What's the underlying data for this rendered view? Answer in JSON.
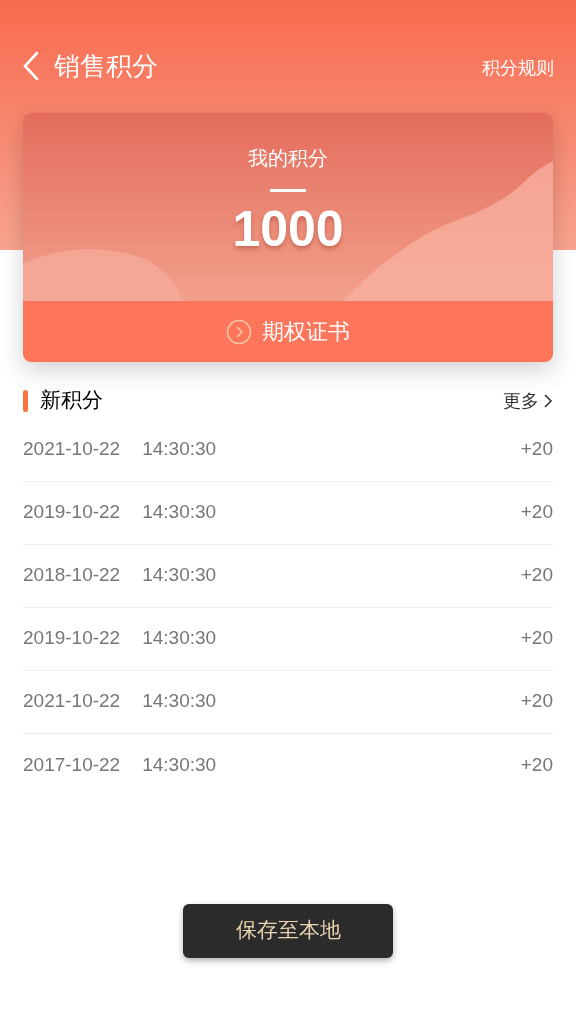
{
  "header": {
    "title": "销售积分",
    "rules_link": "积分规则"
  },
  "points_card": {
    "label": "我的积分",
    "value": "1000",
    "certificate_link": "期权证书"
  },
  "section": {
    "title": "新积分",
    "more_link": "更多"
  },
  "records": [
    {
      "date": "2021-10-22",
      "time": "14:30:30",
      "points": "+20"
    },
    {
      "date": "2019-10-22",
      "time": "14:30:30",
      "points": "+20"
    },
    {
      "date": "2018-10-22",
      "time": "14:30:30",
      "points": "+20"
    },
    {
      "date": "2019-10-22",
      "time": "14:30:30",
      "points": "+20"
    },
    {
      "date": "2021-10-22",
      "time": "14:30:30",
      "points": "+20"
    },
    {
      "date": "2017-10-22",
      "time": "14:30:30",
      "points": "+20"
    }
  ],
  "save_button": "保存至本地"
}
